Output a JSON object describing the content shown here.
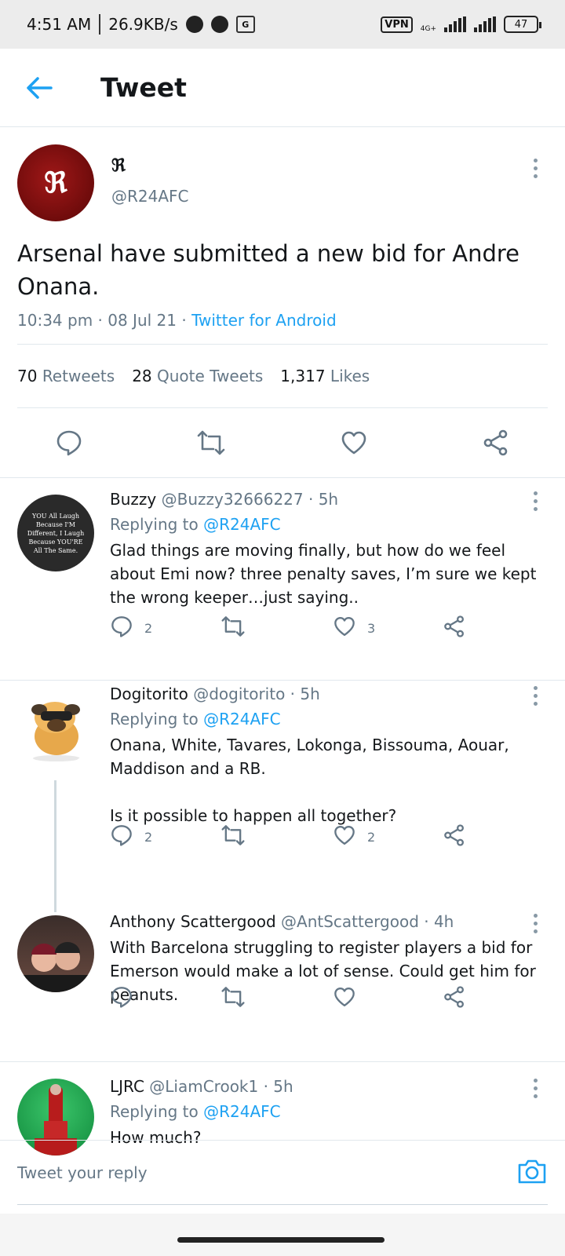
{
  "status_bar": {
    "time": "4:51 AM",
    "speed": "26.9KB/s",
    "vpn": "VPN",
    "network": "4G+",
    "battery": "47"
  },
  "header": {
    "title": "Tweet"
  },
  "main_tweet": {
    "avatar_letter": "ℜ",
    "name": "ℜ",
    "handle": "@R24AFC",
    "text": "Arsenal have submitted a new bid for Andre Onana.",
    "time": "10:34 pm · 08 Jul 21 · ",
    "source": "Twitter for Android",
    "retweets_count": "70",
    "retweets_label": "Retweets",
    "quotes_count": "28",
    "quotes_label": "Quote Tweets",
    "likes_count": "1,317",
    "likes_label": "Likes"
  },
  "replies": [
    {
      "name": "Buzzy",
      "handle": "@Buzzy32666227 · 5h",
      "replying_prefix": "Replying to ",
      "replying_to": "@R24AFC",
      "text": "Glad things are moving finally, but how do we feel about Emi now? three penalty saves, I’m sure we kept the wrong keeper…just saying..",
      "avatar_text": "YOU All Laugh Because I'M Different, I Laugh Because YOU'RE All The Same.",
      "reply_count": "2",
      "like_count": "3"
    },
    {
      "name": "Dogitorito",
      "handle": "@dogitorito · 5h",
      "replying_prefix": "Replying to ",
      "replying_to": "@R24AFC",
      "text": "Onana, White, Tavares, Lokonga, Bissouma, Aouar, Maddison and a RB.\n\nIs it possible to happen all together?",
      "reply_count": "2",
      "like_count": "2"
    },
    {
      "name": "Anthony Scattergood",
      "handle": "@AntScattergood · 4h",
      "text": "With Barcelona struggling to register players a bid for Emerson would make a lot of sense. Could get him for peanuts.",
      "reply_count": "",
      "like_count": ""
    },
    {
      "name": "LJRC",
      "handle": "@LiamCrook1 · 5h",
      "replying_prefix": "Replying to ",
      "replying_to": "@R24AFC",
      "text": "How much?"
    }
  ],
  "reply_bar": {
    "placeholder": "Tweet your reply"
  },
  "colors": {
    "accent": "#1da1f2",
    "secondary_text": "#657786",
    "avatar_red": "#8b0a0a"
  }
}
